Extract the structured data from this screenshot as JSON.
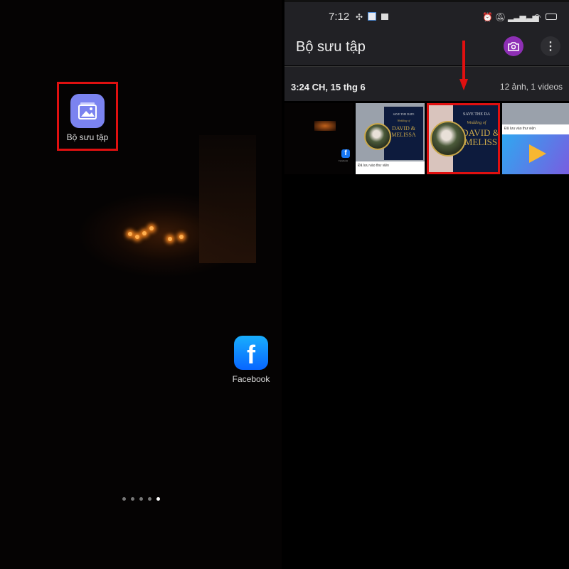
{
  "home": {
    "apps": [
      {
        "label": "Bộ sưu tập",
        "icon": "gallery-icon",
        "color": "#7b83f0",
        "highlighted": true
      },
      {
        "label": "Facebook",
        "icon": "facebook-icon",
        "color": "#1877f2"
      }
    ],
    "page_indicator": {
      "pages": 5,
      "current": 5
    }
  },
  "gallery": {
    "status_bar": {
      "time": "7:12"
    },
    "title": "Bộ sưu tập",
    "camera_button_color": "#8e2fb5",
    "date_header": "3:24 CH, 15 thg 6",
    "count": "12 ảnh, 1 videos",
    "thumbnails": [
      {
        "kind": "home-screenshot",
        "label": "Facebook"
      },
      {
        "kind": "wedding-invite",
        "title": "SAVE THE DATE",
        "subtitle": "Wedding of",
        "names": "DAVID & MELISSA",
        "toast": "Đã lưu vào thư viện"
      },
      {
        "kind": "wedding-invite",
        "title": "SAVE THE DA",
        "subtitle": "Wedding of",
        "names": "DAVID & MELISS",
        "highlighted": true
      },
      {
        "kind": "video-promo",
        "toast": "Đã lưu vào thư viện"
      }
    ],
    "annotation_color": "#e01010"
  }
}
